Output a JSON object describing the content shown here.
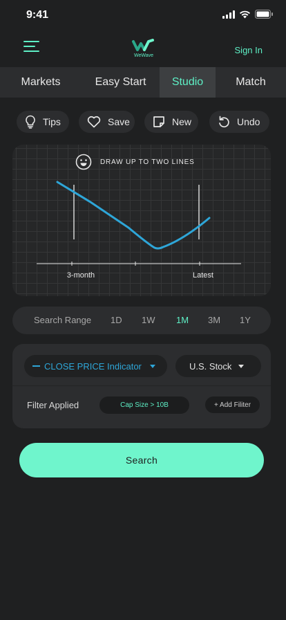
{
  "status_bar": {
    "time": "9:41"
  },
  "header": {
    "logo_text": "WeWave",
    "sign_in": "Sign In"
  },
  "tabs": [
    {
      "label": "Markets"
    },
    {
      "label": "Easy Start"
    },
    {
      "label": "Studio",
      "active": true
    },
    {
      "label": "Match"
    }
  ],
  "toolbar": {
    "tips": "Tips",
    "save": "Save",
    "new": "New",
    "undo": "Undo"
  },
  "chart": {
    "instruction": "DRAW UP TO TWO LINES",
    "marker_left_label": "3-month",
    "marker_right_label": "Latest",
    "line_color": "#2ea6d8"
  },
  "range": {
    "label": "Search Range",
    "options": [
      "1D",
      "1W",
      "1M",
      "3M",
      "1Y"
    ],
    "selected": "1M"
  },
  "filters": {
    "indicator": "CLOSE PRICE Indicator",
    "market": "U.S. Stock",
    "applied_label": "Filter Applied",
    "applied_value": "Cap Size > 10B",
    "add_filter": "+ Add Filiter"
  },
  "search_button": "Search",
  "colors": {
    "accent": "#5ef0c6",
    "background": "#1f2021",
    "panel": "#2c2d2f"
  }
}
